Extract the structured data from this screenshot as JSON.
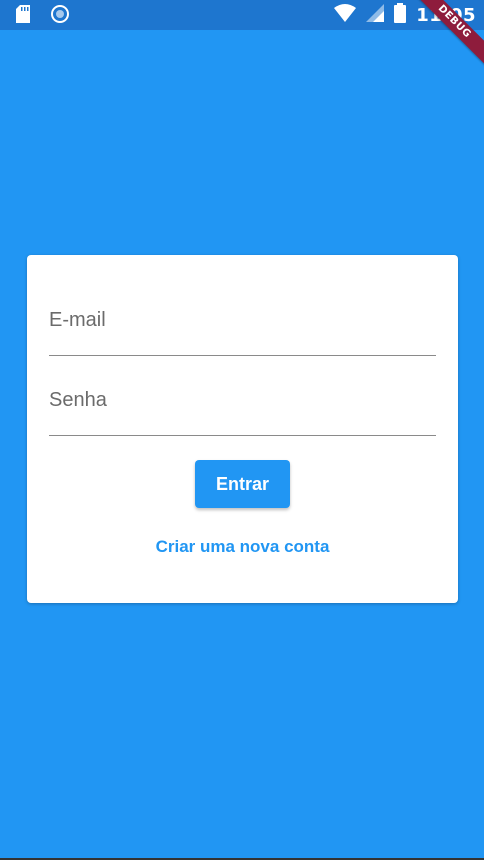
{
  "status_bar": {
    "time": "11:05",
    "icons": [
      "sd-card-icon",
      "sync-icon",
      "wifi-icon",
      "signal-icon",
      "battery-icon"
    ]
  },
  "debug_banner": {
    "label": "DEBUG"
  },
  "login_form": {
    "email_placeholder": "E-mail",
    "password_placeholder": "Senha",
    "submit_label": "Entrar",
    "create_account_label": "Criar uma nova conta"
  },
  "colors": {
    "background": "#2196F3",
    "status_bar": "#1E76CF",
    "card": "#FFFFFF",
    "accent": "#2196F3",
    "debug_banner": "#8E1C3C"
  }
}
